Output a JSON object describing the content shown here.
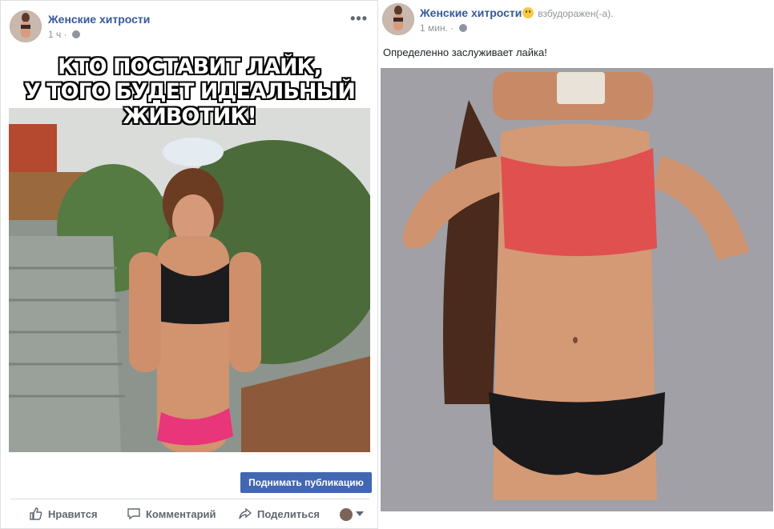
{
  "left_post": {
    "author": "Женские хитрости",
    "time": "1 ч",
    "more_label": "•••",
    "image_caption_line1": "КТО ПОСТАВИТ ЛАЙК,",
    "image_caption_line2": "У ТОГО БУДЕТ ИДЕАЛЬНЫЙ ЖИВОТИК!",
    "boost_label": "Поднимать публикацию",
    "actions": {
      "like": "Нравится",
      "comment": "Комментарий",
      "share": "Поделиться"
    }
  },
  "right_post": {
    "author": "Женские хитрости",
    "status": "взбудоражен(-а).",
    "time": "1 мин.",
    "text": "Определенно заслуживает лайка!"
  },
  "colors": {
    "link_blue": "#365899",
    "button_blue": "#4267b2",
    "meta_gray": "#90949c",
    "action_gray": "#606770"
  },
  "icons": {
    "like": "thumbs-up-icon",
    "comment": "comment-icon",
    "share": "share-arrow-icon",
    "privacy": "globe-icon",
    "emoji": "smiling-face-emoji"
  }
}
